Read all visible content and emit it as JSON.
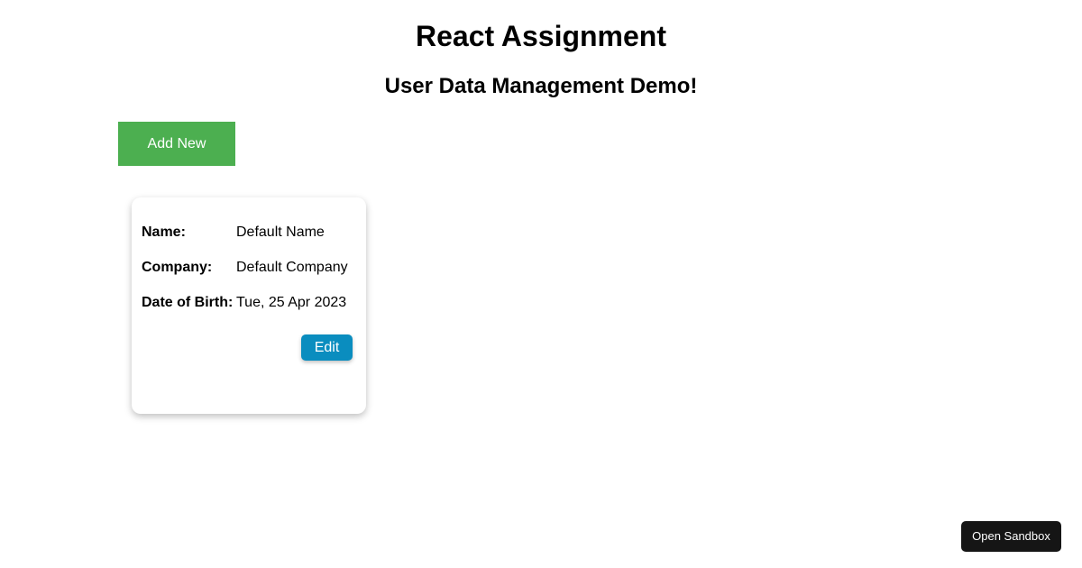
{
  "header": {
    "title": "React Assignment",
    "subtitle": "User Data Management Demo!"
  },
  "toolbar": {
    "add_label": "Add New",
    "add_color": "#4caf50"
  },
  "card": {
    "name_label": "Name:",
    "name_value": "Default Name",
    "company_label": "Company:",
    "company_value": "Default Company",
    "dob_label": "Date of Birth:",
    "dob_value": "Tue, 25 Apr 2023",
    "edit_label": "Edit",
    "edit_color": "#0a8dbf"
  },
  "footer": {
    "sandbox_label": "Open Sandbox"
  }
}
